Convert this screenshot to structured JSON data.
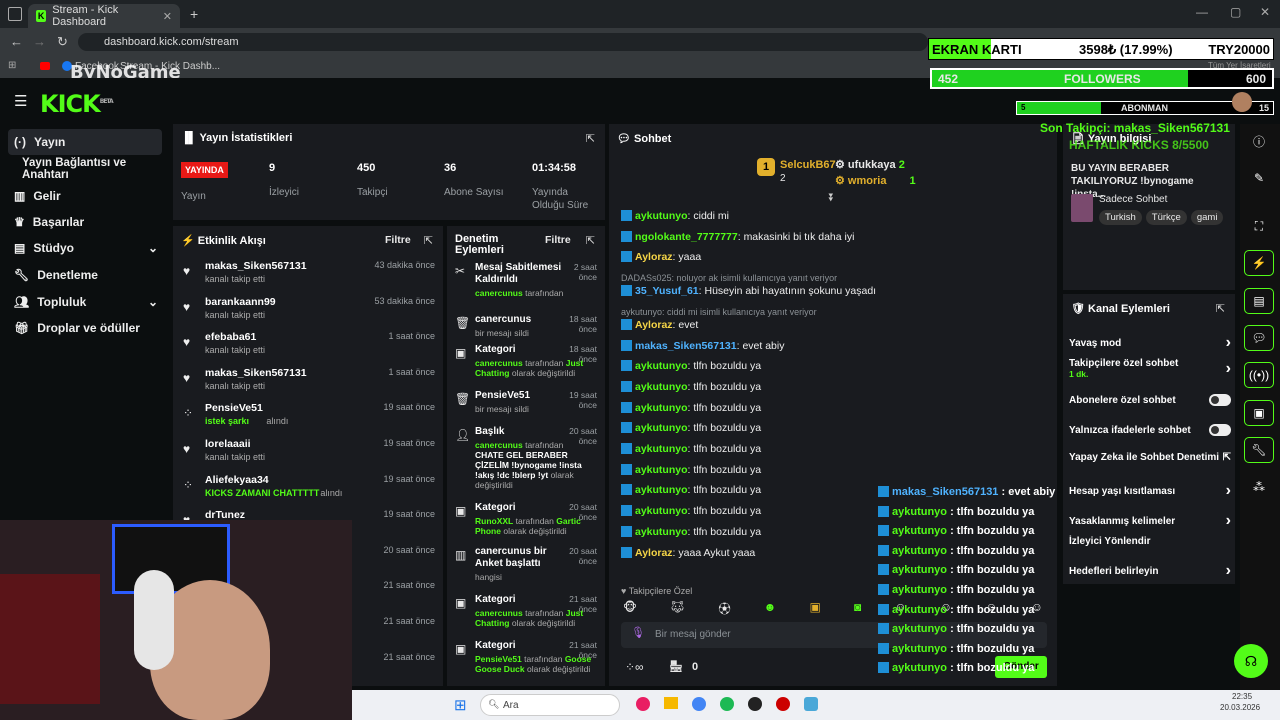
{
  "browser": {
    "tab_title": "Stream - Kick Dashboard",
    "url": "dashboard.kick.com/stream",
    "bookmarks": [
      "Facebook",
      "Stream - Kick Dashb..."
    ],
    "bookmarks_right": "Tüm Yer İşaretleri"
  },
  "logo": "KICK",
  "logo_beta": "BETA",
  "watermark": "ByNoGame",
  "sidebar": {
    "items": [
      {
        "label": "Yayın",
        "icon": "broadcast-icon"
      },
      {
        "label": "Yayın Bağlantısı ve Anahtarı"
      },
      {
        "label": "Gelir",
        "icon": "building-icon"
      },
      {
        "label": "Başarılar",
        "icon": "trophy-icon"
      },
      {
        "label": "Stüdyo",
        "icon": "studio-icon"
      },
      {
        "label": "Denetleme",
        "icon": "wrench-icon"
      },
      {
        "label": "Topluluk",
        "icon": "people-icon"
      },
      {
        "label": "Droplar ve ödüller",
        "icon": "gift-icon"
      }
    ]
  },
  "stats": {
    "title": "Yayın İstatistikleri",
    "live_badge": "YAYINDA",
    "live_label": "Yayın",
    "items": [
      {
        "value": "9",
        "label": "İzleyici"
      },
      {
        "value": "450",
        "label": "Takipçi"
      },
      {
        "value": "36",
        "label": "Abone Sayısı"
      },
      {
        "value": "01:34:58",
        "label": "Yayında Olduğu Süre"
      }
    ]
  },
  "activity": {
    "title": "Etkinlik Akışı",
    "filter": "Filtre",
    "rows": [
      {
        "icon": "heart-icon",
        "name": "makas_Siken567131",
        "desc": "kanalı takip etti",
        "time": "43 dakika önce",
        "green": false
      },
      {
        "icon": "heart-icon",
        "name": "barankaann99",
        "desc": "kanalı takip etti",
        "time": "53 dakika önce",
        "green": false
      },
      {
        "icon": "heart-icon",
        "name": "efebaba61",
        "desc": "kanalı takip etti",
        "time": "1 saat önce",
        "green": false
      },
      {
        "icon": "heart-icon",
        "name": "makas_Siken567131",
        "desc": "kanalı takip etti",
        "time": "1 saat önce",
        "green": false
      },
      {
        "icon": "points-icon",
        "name": "PensieVe51",
        "desc": "istek şarkı",
        "desc2": " alındı",
        "time": "19 saat önce",
        "green": true
      },
      {
        "icon": "heart-icon",
        "name": "lorelaaaii",
        "desc": "kanalı takip etti",
        "time": "19 saat önce",
        "green": false
      },
      {
        "icon": "points-icon",
        "name": "Aliefekyaa34",
        "desc": "KICKS ZAMANI CHATTTTT",
        "desc2": " alındı",
        "time": "19 saat önce",
        "green": true
      },
      {
        "icon": "heart-icon",
        "name": "drTunez",
        "desc": "",
        "time": "19 saat önce",
        "green": false
      },
      {
        "icon": "heart-icon",
        "name": "",
        "desc": "",
        "time": "20 saat önce",
        "green": false
      },
      {
        "icon": "heart-icon",
        "name": "",
        "desc": "",
        "time": "21 saat önce",
        "green": false
      },
      {
        "icon": "heart-icon",
        "name": "",
        "desc": "",
        "time": "21 saat önce",
        "green": false
      },
      {
        "icon": "heart-icon",
        "name": "",
        "desc": "",
        "time": "21 saat önce",
        "green": false
      }
    ]
  },
  "moderation": {
    "title": "Denetim Eylemleri",
    "filter": "Filtre",
    "rows": [
      {
        "icon": "pin-off-icon",
        "name": "Mesaj Sabitlemesi Kaldırıldı",
        "time": "2 saat önce",
        "who": "canercunus",
        "rest": " tarafından"
      },
      {
        "icon": "trash-icon",
        "name": "canercunus",
        "time": "18 saat önce",
        "d": "bir mesajı sildi"
      },
      {
        "icon": "category-icon",
        "name": "Kategori",
        "time": "18 saat önce",
        "who": "canercunus",
        "rest": " tarafından ",
        "hl": "Just Chatting",
        "rest2": " olarak değiştirildi"
      },
      {
        "icon": "trash-icon",
        "name": "PensieVe51",
        "time": "19 saat önce",
        "d": "bir mesajı sildi"
      },
      {
        "icon": "title-icon",
        "name": "Başlık",
        "time": "20 saat önce",
        "who": "canercunus",
        "rest": " tarafından",
        "bold": "CHATE GEL BERABER ÇİZELİM !bynogame !insta !akış !dc !blerp !yt",
        "rest2": " olarak değiştirildi"
      },
      {
        "icon": "category-icon",
        "name": "Kategori",
        "time": "20 saat önce",
        "who": "RunoXXL",
        "rest": " tarafından ",
        "hl": "Gartic Phone",
        "rest2": " olarak değiştirildi"
      },
      {
        "icon": "poll-icon",
        "name": "canercunus bir Anket başlattı",
        "time": "20 saat önce",
        "d": "hangisi"
      },
      {
        "icon": "category-icon",
        "name": "Kategori",
        "time": "21 saat önce",
        "who": "canercunus",
        "rest": " tarafından ",
        "hl": "Just Chatting",
        "rest2": " olarak değiştirildi"
      },
      {
        "icon": "category-icon",
        "name": "Kategori",
        "time": "21 saat önce",
        "who": "PensieVe51",
        "rest": " tarafından ",
        "hl": "Goose Goose Duck",
        "rest2": " olarak değiştirildi"
      }
    ]
  },
  "chat": {
    "title": "Sohbet",
    "top_gifters": [
      {
        "rank": "1",
        "name": "SelcukB67",
        "count": "2"
      },
      {
        "name": "ufukkaya",
        "count": "2"
      },
      {
        "name": "wmoria",
        "count": "1"
      }
    ],
    "lines": [
      {
        "type": "msg",
        "user": "aykutunyo",
        "text": "ciddi mi",
        "color": "#53fc18"
      },
      {
        "type": "msg",
        "user": "ngolokante_7777777",
        "text": "makasinki bi tık daha iyi",
        "color": "#53fc18"
      },
      {
        "type": "msg",
        "user": "Ayloraz",
        "text": "yaaa",
        "color": "#f5d547"
      },
      {
        "type": "reply",
        "text": "DADASs025: noluyor ak isimli kullanıcıya yanıt veriyor"
      },
      {
        "type": "msg",
        "user": "35_Yusuf_61",
        "text": "Hüseyin abi hayatının şokunu yaşadı",
        "color": "#4fb3ff"
      },
      {
        "type": "reply",
        "text": "aykutunyo: ciddi mi isimli kullanıcıya yanıt veriyor"
      },
      {
        "type": "msg",
        "user": "Ayloraz",
        "text": "evet",
        "color": "#f5d547"
      },
      {
        "type": "msg",
        "user": "makas_Siken567131",
        "text": "evet abiy",
        "color": "#4fb3ff"
      },
      {
        "type": "msg",
        "user": "aykutunyo",
        "text": "tlfn bozuldu ya",
        "color": "#53fc18"
      },
      {
        "type": "msg",
        "user": "aykutunyo",
        "text": "tlfn bozuldu ya",
        "color": "#53fc18"
      },
      {
        "type": "msg",
        "user": "aykutunyo",
        "text": "tlfn bozuldu ya",
        "color": "#53fc18"
      },
      {
        "type": "msg",
        "user": "aykutunyo",
        "text": "tlfn bozuldu ya",
        "color": "#53fc18"
      },
      {
        "type": "msg",
        "user": "aykutunyo",
        "text": "tlfn bozuldu ya",
        "color": "#53fc18"
      },
      {
        "type": "msg",
        "user": "aykutunyo",
        "text": "tlfn bozuldu ya",
        "color": "#53fc18"
      },
      {
        "type": "msg",
        "user": "aykutunyo",
        "text": "tlfn bozuldu ya",
        "color": "#53fc18"
      },
      {
        "type": "msg",
        "user": "aykutunyo",
        "text": "tlfn bozuldu ya",
        "color": "#53fc18"
      },
      {
        "type": "msg",
        "user": "aykutunyo",
        "text": "tlfn bozuldu ya",
        "color": "#53fc18"
      },
      {
        "type": "msg",
        "user": "Ayloraz",
        "text": "yaaa Aykut yaaa",
        "color": "#f5d547"
      }
    ],
    "followers_only": "Takipçilere Özel",
    "input_placeholder": "Bir mesaj gönder",
    "points": "0",
    "send": "Gönder"
  },
  "stream_info": {
    "title": "Yayın bilgisi",
    "overlay_goal": "HAFTALIK KICKS 8/5500",
    "desc": "BU YAYIN BERABER TAKILIYORUZ !bynogame !insta...",
    "sub_chat": "Sadece Sohbet",
    "tags": [
      "Turkish",
      "Türkçe",
      "gami"
    ]
  },
  "channel_actions": {
    "title": "Kanal Eylemleri",
    "rows": [
      {
        "label": "Yavaş mod",
        "kind": "arrow"
      },
      {
        "label": "Takipçilere özel sohbet",
        "sub": "1 dk.",
        "kind": "arrow"
      },
      {
        "label": "Abonelere özel sohbet",
        "kind": "toggle"
      },
      {
        "label": "Yalnızca ifadelerle sohbet",
        "kind": "toggle"
      },
      {
        "label": "Yapay Zeka ile Sohbet Denetimi",
        "kind": "ext"
      },
      {
        "label": "Hesap yaşı kısıtlaması",
        "kind": "arrow"
      },
      {
        "label": "Yasaklanmış kelimeler",
        "kind": "arrow"
      },
      {
        "label": "İzleyici Yönlendir",
        "kind": "none"
      },
      {
        "label": "Hedefleri belirleyin",
        "kind": "arrow"
      }
    ]
  },
  "overlay": {
    "gpu_label": "EKRAN KARTI",
    "gpu_price": "3598₺ (17.99%)",
    "gpu_target": "TRY20000",
    "gpu_progress": 0.18,
    "followers_cur": "452",
    "followers_label": "FOLLOWERS",
    "followers_goal": "600",
    "followers_progress": 0.753,
    "subs_cur": "5",
    "subs_label": "ABONMAN",
    "subs_goal": "15",
    "subs_progress": 0.33,
    "last_follower": "Son Takipçi: makas_Siken567131",
    "chat": [
      {
        "user": "makas_Siken567131",
        "text": "evet abiy"
      },
      {
        "user": "aykutunyo",
        "text": "tlfn bozuldu ya"
      },
      {
        "user": "aykutunyo",
        "text": "tlfn bozuldu ya"
      },
      {
        "user": "aykutunyo",
        "text": "tlfn bozuldu ya"
      },
      {
        "user": "aykutunyo",
        "text": "tlfn bozuldu ya"
      },
      {
        "user": "aykutunyo",
        "text": "tlfn bozuldu ya"
      },
      {
        "user": "aykutunyo",
        "text": "tlfn bozuldu ya"
      },
      {
        "user": "aykutunyo",
        "text": "tlfn bozuldu ya"
      },
      {
        "user": "aykutunyo",
        "text": "tlfn bozuldu ya"
      },
      {
        "user": "aykutunyo",
        "text": "tlfn bozuldu ya"
      }
    ]
  },
  "taskbar": {
    "search": "Ara",
    "time": "22:35",
    "date": "20.03.2026"
  },
  "colors": {
    "accent": "#53fc18",
    "panel": "#191b1f",
    "bg": "#0b0e0f",
    "live": "#e91916"
  }
}
